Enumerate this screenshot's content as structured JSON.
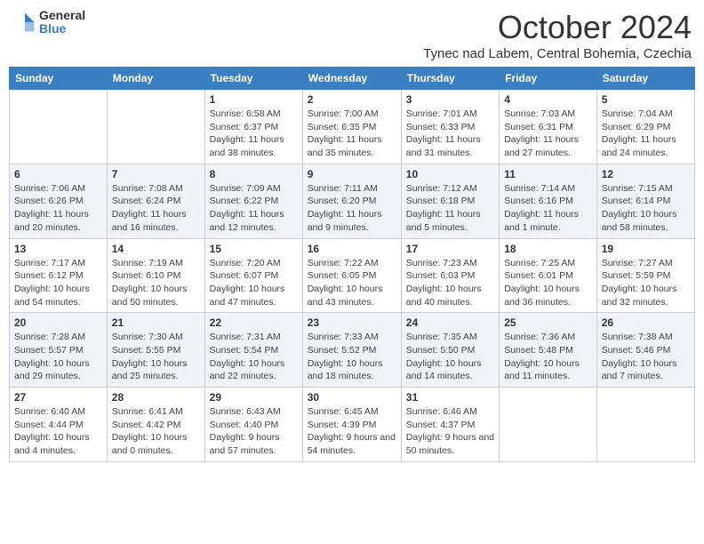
{
  "header": {
    "logo_general": "General",
    "logo_blue": "Blue",
    "month_title": "October 2024",
    "subtitle": "Tynec nad Labem, Central Bohemia, Czechia"
  },
  "days_of_week": [
    "Sunday",
    "Monday",
    "Tuesday",
    "Wednesday",
    "Thursday",
    "Friday",
    "Saturday"
  ],
  "weeks": [
    [
      {
        "day": "",
        "info": ""
      },
      {
        "day": "",
        "info": ""
      },
      {
        "day": "1",
        "info": "Sunrise: 6:58 AM\nSunset: 6:37 PM\nDaylight: 11 hours and 38 minutes."
      },
      {
        "day": "2",
        "info": "Sunrise: 7:00 AM\nSunset: 6:35 PM\nDaylight: 11 hours and 35 minutes."
      },
      {
        "day": "3",
        "info": "Sunrise: 7:01 AM\nSunset: 6:33 PM\nDaylight: 11 hours and 31 minutes."
      },
      {
        "day": "4",
        "info": "Sunrise: 7:03 AM\nSunset: 6:31 PM\nDaylight: 11 hours and 27 minutes."
      },
      {
        "day": "5",
        "info": "Sunrise: 7:04 AM\nSunset: 6:29 PM\nDaylight: 11 hours and 24 minutes."
      }
    ],
    [
      {
        "day": "6",
        "info": "Sunrise: 7:06 AM\nSunset: 6:26 PM\nDaylight: 11 hours and 20 minutes."
      },
      {
        "day": "7",
        "info": "Sunrise: 7:08 AM\nSunset: 6:24 PM\nDaylight: 11 hours and 16 minutes."
      },
      {
        "day": "8",
        "info": "Sunrise: 7:09 AM\nSunset: 6:22 PM\nDaylight: 11 hours and 12 minutes."
      },
      {
        "day": "9",
        "info": "Sunrise: 7:11 AM\nSunset: 6:20 PM\nDaylight: 11 hours and 9 minutes."
      },
      {
        "day": "10",
        "info": "Sunrise: 7:12 AM\nSunset: 6:18 PM\nDaylight: 11 hours and 5 minutes."
      },
      {
        "day": "11",
        "info": "Sunrise: 7:14 AM\nSunset: 6:16 PM\nDaylight: 11 hours and 1 minute."
      },
      {
        "day": "12",
        "info": "Sunrise: 7:15 AM\nSunset: 6:14 PM\nDaylight: 10 hours and 58 minutes."
      }
    ],
    [
      {
        "day": "13",
        "info": "Sunrise: 7:17 AM\nSunset: 6:12 PM\nDaylight: 10 hours and 54 minutes."
      },
      {
        "day": "14",
        "info": "Sunrise: 7:19 AM\nSunset: 6:10 PM\nDaylight: 10 hours and 50 minutes."
      },
      {
        "day": "15",
        "info": "Sunrise: 7:20 AM\nSunset: 6:07 PM\nDaylight: 10 hours and 47 minutes."
      },
      {
        "day": "16",
        "info": "Sunrise: 7:22 AM\nSunset: 6:05 PM\nDaylight: 10 hours and 43 minutes."
      },
      {
        "day": "17",
        "info": "Sunrise: 7:23 AM\nSunset: 6:03 PM\nDaylight: 10 hours and 40 minutes."
      },
      {
        "day": "18",
        "info": "Sunrise: 7:25 AM\nSunset: 6:01 PM\nDaylight: 10 hours and 36 minutes."
      },
      {
        "day": "19",
        "info": "Sunrise: 7:27 AM\nSunset: 5:59 PM\nDaylight: 10 hours and 32 minutes."
      }
    ],
    [
      {
        "day": "20",
        "info": "Sunrise: 7:28 AM\nSunset: 5:57 PM\nDaylight: 10 hours and 29 minutes."
      },
      {
        "day": "21",
        "info": "Sunrise: 7:30 AM\nSunset: 5:55 PM\nDaylight: 10 hours and 25 minutes."
      },
      {
        "day": "22",
        "info": "Sunrise: 7:31 AM\nSunset: 5:54 PM\nDaylight: 10 hours and 22 minutes."
      },
      {
        "day": "23",
        "info": "Sunrise: 7:33 AM\nSunset: 5:52 PM\nDaylight: 10 hours and 18 minutes."
      },
      {
        "day": "24",
        "info": "Sunrise: 7:35 AM\nSunset: 5:50 PM\nDaylight: 10 hours and 14 minutes."
      },
      {
        "day": "25",
        "info": "Sunrise: 7:36 AM\nSunset: 5:48 PM\nDaylight: 10 hours and 11 minutes."
      },
      {
        "day": "26",
        "info": "Sunrise: 7:38 AM\nSunset: 5:46 PM\nDaylight: 10 hours and 7 minutes."
      }
    ],
    [
      {
        "day": "27",
        "info": "Sunrise: 6:40 AM\nSunset: 4:44 PM\nDaylight: 10 hours and 4 minutes."
      },
      {
        "day": "28",
        "info": "Sunrise: 6:41 AM\nSunset: 4:42 PM\nDaylight: 10 hours and 0 minutes."
      },
      {
        "day": "29",
        "info": "Sunrise: 6:43 AM\nSunset: 4:40 PM\nDaylight: 9 hours and 57 minutes."
      },
      {
        "day": "30",
        "info": "Sunrise: 6:45 AM\nSunset: 4:39 PM\nDaylight: 9 hours and 54 minutes."
      },
      {
        "day": "31",
        "info": "Sunrise: 6:46 AM\nSunset: 4:37 PM\nDaylight: 9 hours and 50 minutes."
      },
      {
        "day": "",
        "info": ""
      },
      {
        "day": "",
        "info": ""
      }
    ]
  ]
}
